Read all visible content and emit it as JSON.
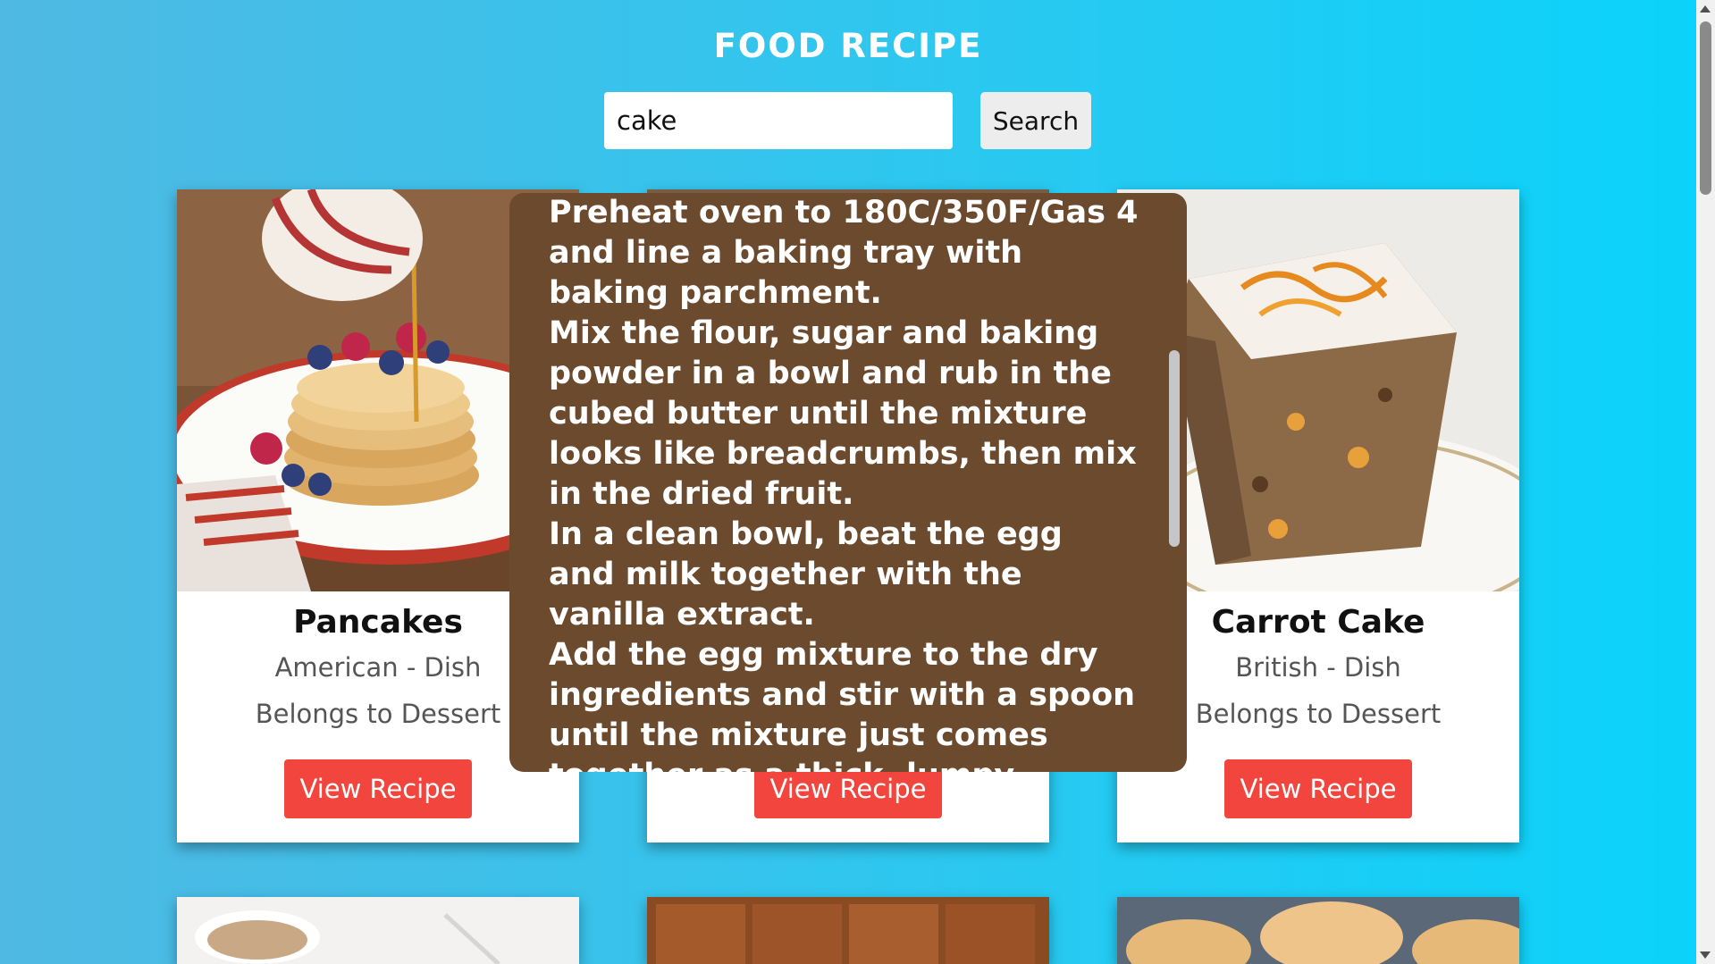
{
  "header": {
    "title": "FOOD RECIPE"
  },
  "search": {
    "value": "cake",
    "button_label": "Search"
  },
  "cards": [
    {
      "name": "Pancakes",
      "origin": "American - Dish",
      "category": "Belongs to Dessert",
      "button": "View Recipe",
      "image": "pancakes-photo"
    },
    {
      "name": "",
      "origin": "",
      "category": "",
      "button": "View Recipe",
      "image": "cake-photo"
    },
    {
      "name": "Carrot Cake",
      "origin": "British - Dish",
      "category": "Belongs to Dessert",
      "button": "View Recipe",
      "image": "carrot-cake-photo"
    }
  ],
  "bottom_cards": [
    {
      "image": "milk-pudding-photo"
    },
    {
      "image": "brownie-squares-photo"
    },
    {
      "image": "pastries-photo"
    }
  ],
  "recipe_popup": {
    "instructions": "Preheat oven to 180C/350F/Gas 4 and line a baking tray with baking parchment.\nMix the flour, sugar and baking powder in a bowl and rub in the cubed butter until the mixture looks like breadcrumbs, then mix in the dried fruit.\nIn a clean bowl, beat the egg and milk together with the vanilla extract.\nAdd the egg mixture to the dry ingredients and stir with a spoon until the mixture just comes together as a thick, lumpy"
  },
  "colors": {
    "background_start": "#4fb9e3",
    "background_end": "#0ad3fb",
    "button_red": "#f1453d",
    "popup_brown": "#6b4a2e"
  }
}
